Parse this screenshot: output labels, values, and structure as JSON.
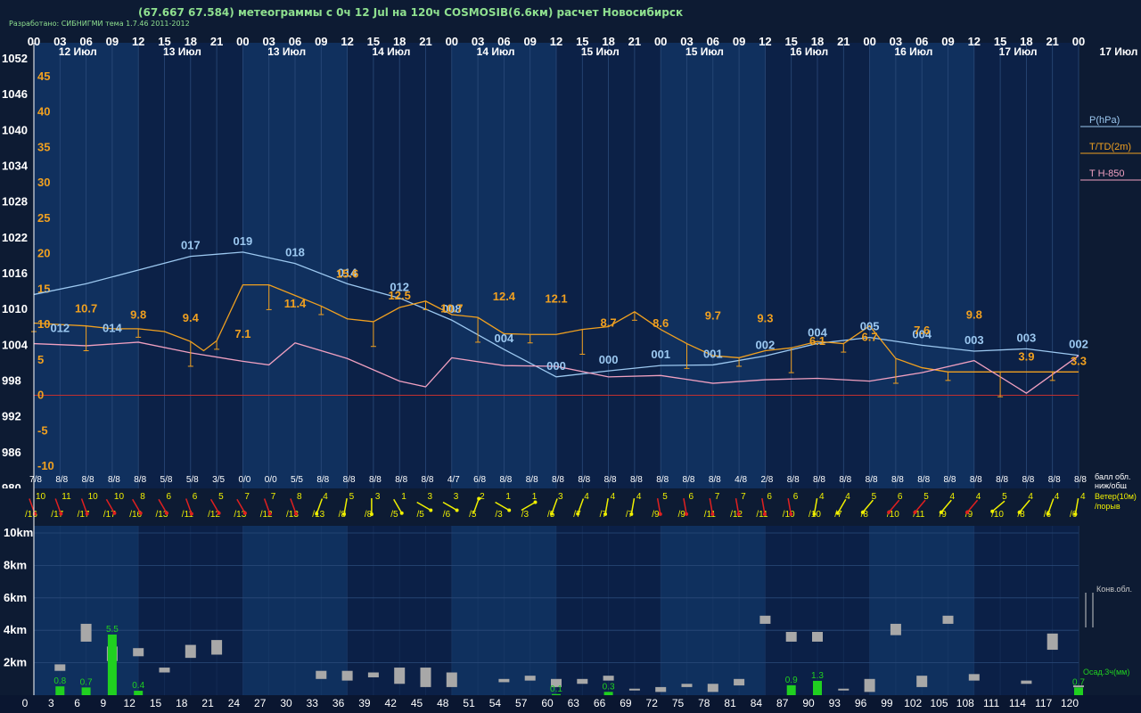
{
  "title": "(67.667 67.584) метеограммы с  0ч 12 Jul на 120ч COSMOSIB(6.6км) расчет Новосибирск",
  "developer": "Разработано: СИБНИГМИ тема 1.7.46 2011-2012",
  "colors": {
    "background": "#0d1b33",
    "band_light": "#10305e",
    "band_dark": "#0c2147",
    "pressure": "#9cc8f0",
    "temperature": "#f0a020",
    "t850": "#f0a0c0",
    "zero_line": "#c03030",
    "cloud_bar": "#a8a8a8",
    "precip": "#20d020",
    "wind_red": "#e02020",
    "wind_yellow": "#f0f000",
    "axis_text": "#ffffff",
    "legend_text": "#f0a020"
  },
  "chart_data": {
    "type": "line",
    "top_hour_ticks": [
      "00",
      "03",
      "06",
      "09",
      "12",
      "15",
      "18",
      "21",
      "00",
      "03",
      "06",
      "09",
      "12",
      "15",
      "18",
      "21",
      "00",
      "03",
      "06",
      "09",
      "12",
      "15",
      "18",
      "21",
      "00",
      "03",
      "06",
      "09",
      "12",
      "15",
      "18",
      "21",
      "00",
      "03",
      "06",
      "09",
      "12",
      "15",
      "18",
      "21",
      "00"
    ],
    "date_labels": [
      {
        "hour": 3,
        "label": "12 Июл"
      },
      {
        "hour": 15,
        "label": "13 Июл"
      },
      {
        "hour": 27,
        "label": "13 Июл"
      },
      {
        "hour": 39,
        "label": "14 Июл"
      },
      {
        "hour": 51,
        "label": "14 Июл"
      },
      {
        "hour": 63,
        "label": "15 Июл"
      },
      {
        "hour": 75,
        "label": "15 Июл"
      },
      {
        "hour": 87,
        "label": "16 Июл"
      },
      {
        "hour": 99,
        "label": "16 Июл"
      },
      {
        "hour": 111,
        "label": "17 Июл"
      }
    ],
    "right_date_label": "17 Июл",
    "pressure_axis": {
      "ticks": [
        1052,
        1046,
        1040,
        1034,
        1028,
        1022,
        1016,
        1010,
        1004,
        998,
        992,
        986,
        980
      ],
      "range": [
        980,
        1052
      ]
    },
    "temperature_axis": {
      "ticks": [
        45,
        40,
        35,
        30,
        25,
        20,
        15,
        10,
        5,
        0,
        -5,
        -10
      ],
      "range": [
        -13,
        50
      ]
    },
    "legend": [
      {
        "label": "P(hPa)",
        "color": "#9cc8f0"
      },
      {
        "label": "T/TD(2m)",
        "color": "#f0a020"
      },
      {
        "label": "T H-850",
        "color": "#f0a0c0"
      }
    ],
    "series": [
      {
        "name": "P(hPa)",
        "hours": [
          0,
          6,
          12,
          18,
          24,
          30,
          36,
          42,
          48,
          54,
          60,
          66,
          72,
          78,
          84,
          90,
          96,
          102,
          108,
          114,
          120
        ],
        "values": [
          1012.5,
          1014.3,
          1016.6,
          1018.9,
          1019.6,
          1017.7,
          1014.3,
          1011.9,
          1008.2,
          1003.3,
          998.7,
          999.7,
          1000.6,
          1000.7,
          1002.2,
          1004.3,
          1005.3,
          1004.0,
          1003.0,
          1003.4,
          1002.3
        ]
      },
      {
        "name": "T/TD(2m)",
        "hours": [
          0,
          6,
          12,
          18,
          24,
          30,
          36,
          42,
          48,
          54,
          60,
          66,
          72,
          78,
          84,
          90,
          96,
          102,
          108,
          114,
          120
        ],
        "values": [
          11.0,
          10.7,
          9.8,
          9.8,
          9.4,
          7.1,
          15.6,
          15.4,
          12.5,
          10.7,
          12.4,
          13.6,
          12.1,
          8.7,
          8.6,
          9.7,
          9.3,
          6.1,
          6.7,
          7.6,
          9.8,
          3.9,
          3.3
        ]
      },
      {
        "name": "T H-850",
        "hours": [
          0,
          6,
          12,
          18,
          24,
          27,
          30,
          36,
          42,
          45,
          48,
          54,
          60,
          66,
          72,
          78,
          84,
          90,
          96,
          102,
          108,
          114,
          120
        ],
        "values": [
          7.3,
          7.0,
          7.5,
          6.0,
          4.8,
          4.3,
          7.4,
          5.2,
          2.0,
          1.2,
          5.3,
          4.2,
          4.1,
          2.6,
          2.8,
          1.7,
          2.2,
          2.4,
          2.0,
          3.2,
          4.9,
          0.3,
          5.6
        ]
      }
    ],
    "pressure_labels": [
      {
        "hour": 3,
        "text": "012"
      },
      {
        "hour": 9,
        "text": "014"
      },
      {
        "hour": 18,
        "text": "017"
      },
      {
        "hour": 24,
        "text": "019"
      },
      {
        "hour": 30,
        "text": "018"
      },
      {
        "hour": 36,
        "text": "014"
      },
      {
        "hour": 42,
        "text": "012"
      },
      {
        "hour": 48,
        "text": "008"
      },
      {
        "hour": 54,
        "text": "004"
      },
      {
        "hour": 60,
        "text": "000"
      },
      {
        "hour": 66,
        "text": "000"
      },
      {
        "hour": 72,
        "text": "001"
      },
      {
        "hour": 78,
        "text": "001"
      },
      {
        "hour": 84,
        "text": "002"
      },
      {
        "hour": 90,
        "text": "004"
      },
      {
        "hour": 96,
        "text": "005"
      },
      {
        "hour": 102,
        "text": "004"
      },
      {
        "hour": 108,
        "text": "003"
      },
      {
        "hour": 114,
        "text": "003"
      },
      {
        "hour": 120,
        "text": "002"
      }
    ],
    "temperature_labels": [
      {
        "hour": 0,
        "text": "15",
        "value": 15
      },
      {
        "hour": 0,
        "text": "10",
        "value": 10
      },
      {
        "hour": 12,
        "text": "10.7",
        "value": 10.7
      },
      {
        "hour": 24,
        "text": "9.8",
        "value": 9.8
      },
      {
        "hour": 36,
        "text": "9.4",
        "value": 9.4
      },
      {
        "hour": 48,
        "text": "7.1",
        "value": 7.1
      },
      {
        "hour": 60,
        "text": "11.4",
        "value": 11.4
      },
      {
        "hour": 72,
        "text": "15.6",
        "value": 15.6
      },
      {
        "hour": 84,
        "text": "12.5",
        "value": 12.5
      },
      {
        "hour": 96,
        "text": "10.7",
        "value": 10.7
      },
      {
        "hour": 108,
        "text": "12.4",
        "value": 12.4
      },
      {
        "hour": 120,
        "text": "12.1",
        "value": 12.1
      },
      {
        "hour": 132,
        "text": "8.7",
        "value": 8.7
      },
      {
        "hour": 144,
        "text": "8.6",
        "value": 8.6
      },
      {
        "hour": 156,
        "text": "9.7",
        "value": 9.7
      },
      {
        "hour": 168,
        "text": "9.3",
        "value": 9.3
      },
      {
        "hour": 180,
        "text": "6.1",
        "value": 6.1
      },
      {
        "hour": 192,
        "text": "6.7",
        "value": 6.7
      },
      {
        "hour": 204,
        "text": "7.6",
        "value": 7.6
      },
      {
        "hour": 216,
        "text": "9.8",
        "value": 9.8
      },
      {
        "hour": 228,
        "text": "3.9",
        "value": 3.9
      },
      {
        "hour": 240,
        "text": "3.3",
        "value": 3.3
      }
    ],
    "temperature_points": [
      {
        "hour": 0,
        "t": 10.2
      },
      {
        "hour": 6,
        "t": 10.0
      },
      {
        "hour": 12,
        "t": 9.8
      },
      {
        "hour": 18,
        "t": 9.4
      },
      {
        "hour": 24,
        "t": 9.4
      },
      {
        "hour": 30,
        "t": 9.0
      },
      {
        "hour": 36,
        "t": 7.6
      },
      {
        "hour": 39,
        "t": 6.3
      },
      {
        "hour": 42,
        "t": 7.7
      },
      {
        "hour": 48,
        "t": 15.6
      },
      {
        "hour": 54,
        "t": 15.6
      },
      {
        "hour": 60,
        "t": 14.1
      },
      {
        "hour": 66,
        "t": 12.6
      },
      {
        "hour": 72,
        "t": 10.8
      },
      {
        "hour": 78,
        "t": 10.4
      },
      {
        "hour": 84,
        "t": 12.4
      },
      {
        "hour": 90,
        "t": 13.3
      },
      {
        "hour": 96,
        "t": 11.4
      },
      {
        "hour": 102,
        "t": 11.0
      },
      {
        "hour": 108,
        "t": 8.7
      },
      {
        "hour": 114,
        "t": 8.6
      },
      {
        "hour": 120,
        "t": 8.6
      },
      {
        "hour": 126,
        "t": 9.3
      },
      {
        "hour": 132,
        "t": 9.7
      },
      {
        "hour": 138,
        "t": 11.8
      },
      {
        "hour": 144,
        "t": 9.3
      },
      {
        "hour": 150,
        "t": 7.3
      },
      {
        "hour": 156,
        "t": 5.6
      },
      {
        "hour": 162,
        "t": 5.3
      },
      {
        "hour": 168,
        "t": 6.3
      },
      {
        "hour": 174,
        "t": 6.7
      },
      {
        "hour": 180,
        "t": 7.6
      },
      {
        "hour": 186,
        "t": 7.3
      },
      {
        "hour": 192,
        "t": 9.8
      },
      {
        "hour": 198,
        "t": 5.2
      },
      {
        "hour": 204,
        "t": 3.9
      },
      {
        "hour": 210,
        "t": 3.3
      },
      {
        "hour": 216,
        "t": 3.3
      },
      {
        "hour": 222,
        "t": 3.3
      },
      {
        "hour": 228,
        "t": 3.3
      },
      {
        "hour": 234,
        "t": 3.3
      },
      {
        "hour": 240,
        "t": 3.3
      }
    ],
    "cloud_labels": [
      "7/8",
      "8/8",
      "8/8",
      "8/8",
      "8/8",
      "5/8",
      "5/8",
      "3/5",
      "0/0",
      "0/0",
      "5/5",
      "8/8",
      "8/8",
      "8/8",
      "8/8",
      "8/8",
      "4/7",
      "6/8",
      "8/8",
      "8/8",
      "8/8",
      "8/8",
      "8/8",
      "8/8",
      "8/8",
      "8/8",
      "8/8",
      "4/8",
      "2/8",
      "8/8",
      "8/8",
      "8/8",
      "8/8",
      "8/8",
      "8/8",
      "8/8",
      "8/8",
      "8/8",
      "8/8",
      "8/8",
      "8/8"
    ],
    "cloud_label_right": [
      "балл обл.",
      "ниж/общ"
    ],
    "wind": [
      {
        "speed": "10",
        "gust": "/16",
        "color": "red",
        "dir": 160
      },
      {
        "speed": "11",
        "gust": "/17",
        "color": "red",
        "dir": 160
      },
      {
        "speed": "10",
        "gust": "/17",
        "color": "red",
        "dir": 160
      },
      {
        "speed": "10",
        "gust": "/17",
        "color": "red",
        "dir": 150
      },
      {
        "speed": "8",
        "gust": "/16",
        "color": "red",
        "dir": 150
      },
      {
        "speed": "6",
        "gust": "/13",
        "color": "red",
        "dir": 150
      },
      {
        "speed": "6",
        "gust": "/11",
        "color": "red",
        "dir": 160
      },
      {
        "speed": "5",
        "gust": "/12",
        "color": "red",
        "dir": 150
      },
      {
        "speed": "7",
        "gust": "/13",
        "color": "red",
        "dir": 150
      },
      {
        "speed": "7",
        "gust": "/12",
        "color": "red",
        "dir": 160
      },
      {
        "speed": "8",
        "gust": "/13",
        "color": "red",
        "dir": 160
      },
      {
        "speed": "4",
        "gust": "/13",
        "color": "yellow",
        "dir": 200
      },
      {
        "speed": "5",
        "gust": "/8",
        "color": "yellow",
        "dir": 190
      },
      {
        "speed": "3",
        "gust": "/8",
        "color": "yellow",
        "dir": 180
      },
      {
        "speed": "1",
        "gust": "/5",
        "color": "yellow",
        "dir": 150
      },
      {
        "speed": "3",
        "gust": "/5",
        "color": "yellow",
        "dir": 120
      },
      {
        "speed": "3",
        "gust": "/6",
        "color": "yellow",
        "dir": 120
      },
      {
        "speed": "2",
        "gust": "/5",
        "color": "yellow",
        "dir": 20
      },
      {
        "speed": "1",
        "gust": "/3",
        "color": "yellow",
        "dir": 120
      },
      {
        "speed": "1",
        "gust": "/3",
        "color": "yellow",
        "dir": 60
      },
      {
        "speed": "3",
        "gust": "/5",
        "color": "yellow",
        "dir": 200
      },
      {
        "speed": "4",
        "gust": "/7",
        "color": "yellow",
        "dir": 200
      },
      {
        "speed": "4",
        "gust": "/7",
        "color": "yellow",
        "dir": 190
      },
      {
        "speed": "4",
        "gust": "/7",
        "color": "yellow",
        "dir": 190
      },
      {
        "speed": "5",
        "gust": "/9",
        "color": "red",
        "dir": 170
      },
      {
        "speed": "6",
        "gust": "/9",
        "color": "red",
        "dir": 170
      },
      {
        "speed": "7",
        "gust": "/11",
        "color": "red",
        "dir": 170
      },
      {
        "speed": "7",
        "gust": "/12",
        "color": "red",
        "dir": 170
      },
      {
        "speed": "6",
        "gust": "/11",
        "color": "red",
        "dir": 170
      },
      {
        "speed": "6",
        "gust": "/10",
        "color": "red",
        "dir": 170
      },
      {
        "speed": "4",
        "gust": "/10",
        "color": "yellow",
        "dir": 190
      },
      {
        "speed": "4",
        "gust": "/7",
        "color": "yellow",
        "dir": 210
      },
      {
        "speed": "5",
        "gust": "/8",
        "color": "yellow",
        "dir": 220
      },
      {
        "speed": "6",
        "gust": "/10",
        "color": "red",
        "dir": 220
      },
      {
        "speed": "5",
        "gust": "/11",
        "color": "red",
        "dir": 220
      },
      {
        "speed": "4",
        "gust": "/9",
        "color": "yellow",
        "dir": 220
      },
      {
        "speed": "4",
        "gust": "/9",
        "color": "red",
        "dir": 220
      },
      {
        "speed": "5",
        "gust": "/10",
        "color": "yellow",
        "dir": 230
      },
      {
        "speed": "4",
        "gust": "/8",
        "color": "yellow",
        "dir": 220
      },
      {
        "speed": "4",
        "gust": "/6",
        "color": "yellow",
        "dir": 200
      },
      {
        "speed": "4",
        "gust": "/6",
        "color": "yellow",
        "dir": 190
      }
    ],
    "wind_label_right": [
      "Ветер(10м)",
      "/порыв"
    ],
    "height_axis": {
      "ticks": [
        "10km",
        "8km",
        "6km",
        "4km",
        "2km"
      ],
      "range_km": [
        0,
        11
      ]
    },
    "conv_label": "Конв.обл.",
    "precip_label": "Осад.3ч(мм)",
    "bottom_hour_ticks": [
      "0",
      "3",
      "6",
      "9",
      "12",
      "15",
      "18",
      "21",
      "24",
      "27",
      "30",
      "33",
      "36",
      "39",
      "42",
      "45",
      "48",
      "51",
      "54",
      "57",
      "60",
      "63",
      "66",
      "69",
      "72",
      "75",
      "78",
      "81",
      "84",
      "87",
      "90",
      "93",
      "96",
      "99",
      "102",
      "105",
      "108",
      "111",
      "114",
      "117",
      "120"
    ],
    "clouds": [
      {
        "hour": 3,
        "base": 1.5,
        "top": 1.9
      },
      {
        "hour": 6,
        "base": 3.3,
        "top": 4.4
      },
      {
        "hour": 9,
        "base": 2.1,
        "top": 3.0
      },
      {
        "hour": 12,
        "base": 2.4,
        "top": 2.9
      },
      {
        "hour": 15,
        "base": 1.4,
        "top": 1.7
      },
      {
        "hour": 18,
        "base": 2.3,
        "top": 3.1
      },
      {
        "hour": 21,
        "base": 2.5,
        "top": 3.4
      },
      {
        "hour": 33,
        "base": 1.0,
        "top": 1.5
      },
      {
        "hour": 36,
        "base": 0.9,
        "top": 1.5
      },
      {
        "hour": 39,
        "base": 1.1,
        "top": 1.4
      },
      {
        "hour": 42,
        "base": 0.7,
        "top": 1.7
      },
      {
        "hour": 45,
        "base": 0.5,
        "top": 1.7
      },
      {
        "hour": 48,
        "base": 0.5,
        "top": 1.4
      },
      {
        "hour": 54,
        "base": 0.8,
        "top": 1.0
      },
      {
        "hour": 57,
        "base": 0.9,
        "top": 1.2
      },
      {
        "hour": 60,
        "base": 0.5,
        "top": 1.0
      },
      {
        "hour": 63,
        "base": 0.7,
        "top": 1.0
      },
      {
        "hour": 66,
        "base": 0.9,
        "top": 1.2
      },
      {
        "hour": 69,
        "base": 0.3,
        "top": 0.4
      },
      {
        "hour": 72,
        "base": 0.2,
        "top": 0.5
      },
      {
        "hour": 75,
        "base": 0.5,
        "top": 0.7
      },
      {
        "hour": 78,
        "base": 0.2,
        "top": 0.7
      },
      {
        "hour": 81,
        "base": 0.6,
        "top": 1.0
      },
      {
        "hour": 84,
        "base": 4.4,
        "top": 4.9
      },
      {
        "hour": 87,
        "base": 3.3,
        "top": 3.9
      },
      {
        "hour": 90,
        "base": 3.3,
        "top": 3.9
      },
      {
        "hour": 93,
        "base": 0.3,
        "top": 0.4
      },
      {
        "hour": 96,
        "base": 0.2,
        "top": 1.0
      },
      {
        "hour": 99,
        "base": 3.7,
        "top": 4.4
      },
      {
        "hour": 102,
        "base": 0.5,
        "top": 1.2
      },
      {
        "hour": 105,
        "base": 4.4,
        "top": 4.9
      },
      {
        "hour": 108,
        "base": 0.9,
        "top": 1.3
      },
      {
        "hour": 114,
        "base": 0.7,
        "top": 0.9
      },
      {
        "hour": 117,
        "base": 2.8,
        "top": 3.8
      },
      {
        "hour": 120,
        "base": 0.5,
        "top": 0.6
      }
    ],
    "precip": [
      {
        "hour": 3,
        "value": 0.8,
        "label": "0.8"
      },
      {
        "hour": 6,
        "value": 0.7,
        "label": "0.7"
      },
      {
        "hour": 9,
        "value": 5.5,
        "label": "5.5"
      },
      {
        "hour": 12,
        "value": 0.4,
        "label": "0.4"
      },
      {
        "hour": 60,
        "value": 0.1,
        "label": "0.1"
      },
      {
        "hour": 66,
        "value": 0.3,
        "label": "0.3"
      },
      {
        "hour": 87,
        "value": 0.9,
        "label": "0.9"
      },
      {
        "hour": 90,
        "value": 1.3,
        "label": "1.3"
      },
      {
        "hour": 120,
        "value": 0.7,
        "label": "0.7"
      }
    ]
  }
}
